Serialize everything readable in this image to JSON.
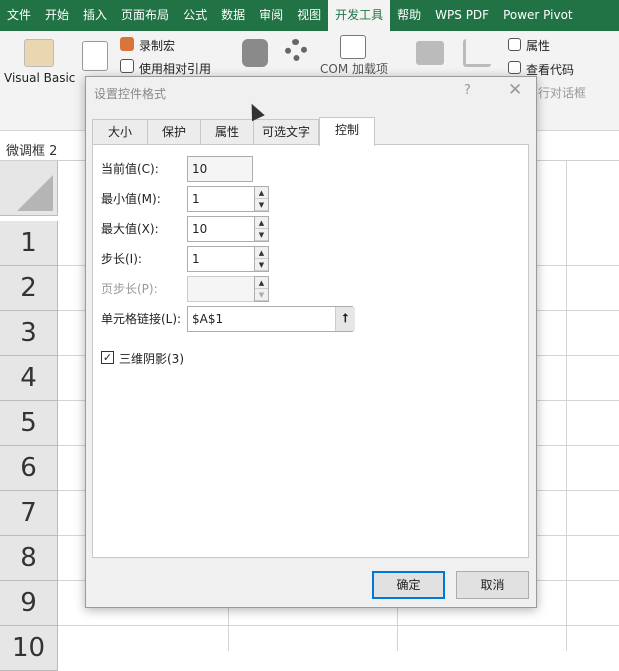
{
  "ribbon_tabs": [
    "文件",
    "开始",
    "插入",
    "页面布局",
    "公式",
    "数据",
    "审阅",
    "视图",
    "开发工具",
    "帮助",
    "WPS PDF",
    "Power Pivot"
  ],
  "active_tab": "开发工具",
  "ribbon": {
    "visual_basic": "Visual Basic",
    "record_macro": "录制宏",
    "relative_ref": "使用相对引用",
    "com_addins": "COM 加载项",
    "properties": "属性",
    "view_code": "查看代码",
    "run_dialog": "行对话框"
  },
  "name_box": "微调框 2",
  "rows": [
    "1",
    "2",
    "3",
    "4",
    "5",
    "6",
    "7",
    "8",
    "9",
    "10"
  ],
  "dialog": {
    "title": "设置控件格式",
    "help": "?",
    "close": "✕",
    "tabs": [
      "大小",
      "保护",
      "属性",
      "可选文字",
      "控制"
    ],
    "active_tab": "控制",
    "fields": {
      "current": {
        "label": "当前值(C):",
        "value": "10"
      },
      "min": {
        "label": "最小值(M):",
        "value": "1"
      },
      "max": {
        "label": "最大值(X):",
        "value": "10"
      },
      "step": {
        "label": "步长(I):",
        "value": "1"
      },
      "page_step": {
        "label": "页步长(P):",
        "value": ""
      },
      "cell_link": {
        "label": "单元格链接(L):",
        "value": "$A$1"
      }
    },
    "shadow": {
      "label": "三维阴影(3)",
      "checked": true
    },
    "ok": "确定",
    "cancel": "取消"
  }
}
